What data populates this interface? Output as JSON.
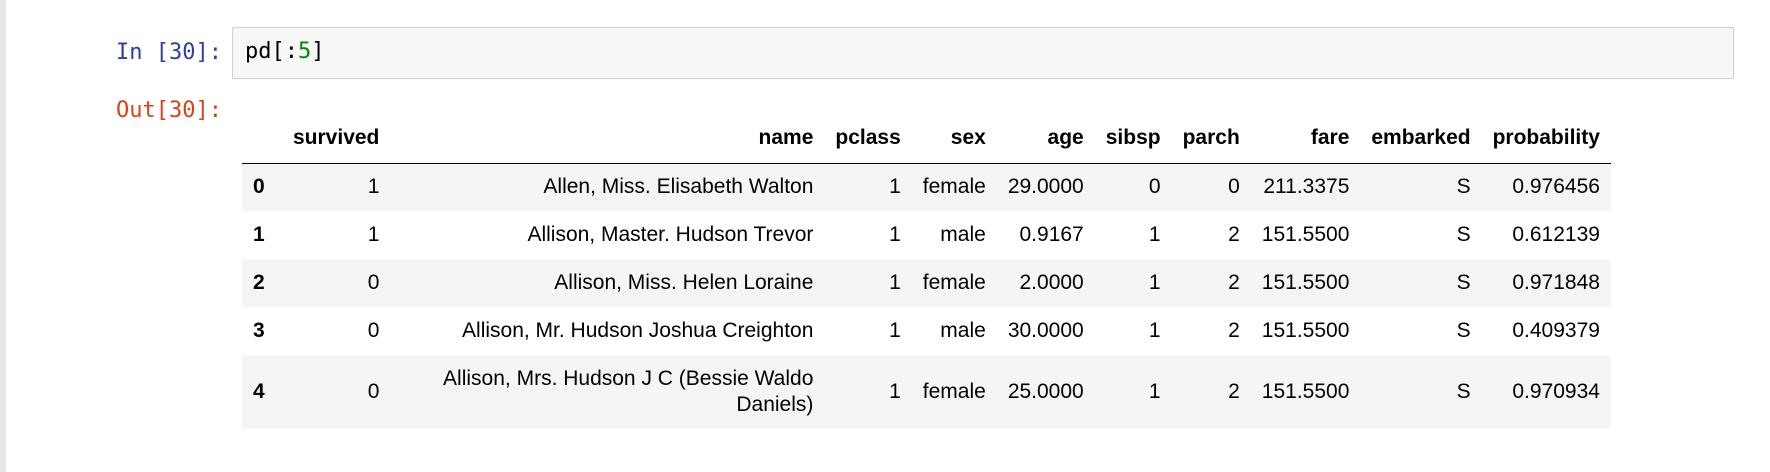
{
  "cell": {
    "in_prompt": "In [30]:",
    "out_prompt": "Out[30]:",
    "code_prefix": "pd[:",
    "code_number": "5",
    "code_suffix": "]"
  },
  "table": {
    "columns": [
      "",
      "survived",
      "name",
      "pclass",
      "sex",
      "age",
      "sibsp",
      "parch",
      "fare",
      "embarked",
      "probability"
    ],
    "rows": [
      {
        "index": "0",
        "survived": "1",
        "name": "Allen, Miss. Elisabeth Walton",
        "pclass": "1",
        "sex": "female",
        "age": "29.0000",
        "sibsp": "0",
        "parch": "0",
        "fare": "211.3375",
        "embarked": "S",
        "probability": "0.976456"
      },
      {
        "index": "1",
        "survived": "1",
        "name": "Allison, Master. Hudson Trevor",
        "pclass": "1",
        "sex": "male",
        "age": "0.9167",
        "sibsp": "1",
        "parch": "2",
        "fare": "151.5500",
        "embarked": "S",
        "probability": "0.612139"
      },
      {
        "index": "2",
        "survived": "0",
        "name": "Allison, Miss. Helen Loraine",
        "pclass": "1",
        "sex": "female",
        "age": "2.0000",
        "sibsp": "1",
        "parch": "2",
        "fare": "151.5500",
        "embarked": "S",
        "probability": "0.971848"
      },
      {
        "index": "3",
        "survived": "0",
        "name": "Allison, Mr. Hudson Joshua Creighton",
        "pclass": "1",
        "sex": "male",
        "age": "30.0000",
        "sibsp": "1",
        "parch": "2",
        "fare": "151.5500",
        "embarked": "S",
        "probability": "0.409379"
      },
      {
        "index": "4",
        "survived": "0",
        "name_line1": "Allison, Mrs. Hudson J C (Bessie Waldo",
        "name_line2": "Daniels)",
        "pclass": "1",
        "sex": "female",
        "age": "25.0000",
        "sibsp": "1",
        "parch": "2",
        "fare": "151.5500",
        "embarked": "S",
        "probability": "0.970934"
      }
    ]
  }
}
